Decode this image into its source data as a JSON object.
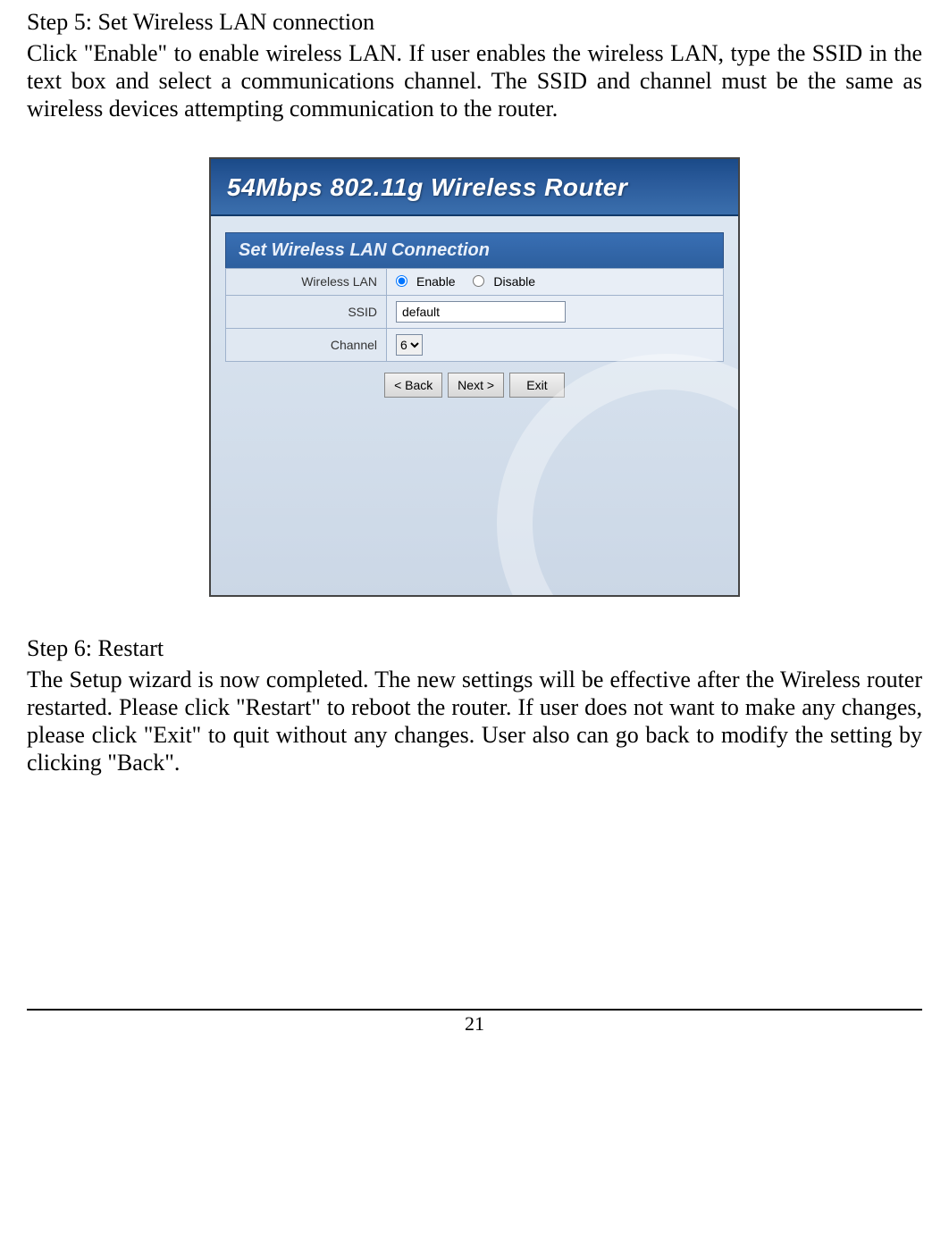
{
  "step5": {
    "heading": "Step 5: Set Wireless LAN connection",
    "body": "Click \"Enable\" to enable wireless LAN. If user enables the wireless LAN, type the SSID in the text box and select a communications channel. The SSID and channel must be the same as wireless devices attempting communication to the router."
  },
  "router": {
    "title": "54Mbps 802.11g Wireless Router",
    "section_header": "Set Wireless LAN Connection",
    "rows": {
      "wlan_label": "Wireless LAN",
      "enable_label": "Enable",
      "disable_label": "Disable",
      "ssid_label": "SSID",
      "ssid_value": "default",
      "channel_label": "Channel",
      "channel_value": "6"
    },
    "buttons": {
      "back": "< Back",
      "next": "Next >",
      "exit": "Exit"
    }
  },
  "step6": {
    "heading": "Step 6: Restart",
    "body": "The Setup wizard is now completed. The new settings will be effective after the Wireless router restarted. Please click \"Restart\" to reboot the router. If user does not want to make any changes, please click \"Exit\" to quit without any changes. User also can go back to modify the setting by clicking \"Back\"."
  },
  "page_number": "21"
}
